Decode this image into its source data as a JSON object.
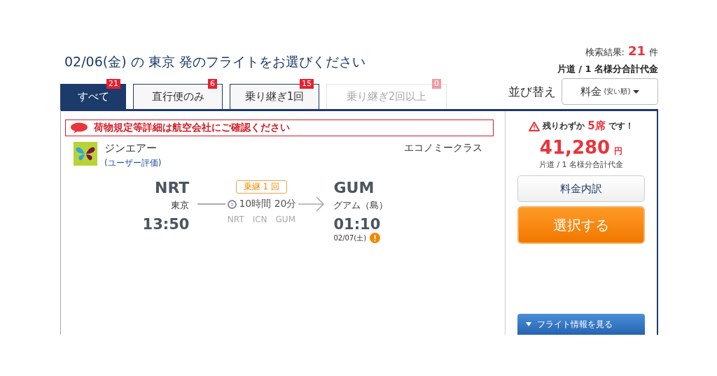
{
  "header": {
    "title": "02/06(金) の 東京 発のフライトをお選びください",
    "results_label": "検索結果:",
    "results_count": "21",
    "results_unit": "件",
    "fare_note": "片道 / 1 名様分合計代金"
  },
  "tabs": [
    {
      "label": "すべて",
      "count": "21",
      "selected": true,
      "disabled": false
    },
    {
      "label": "直行便のみ",
      "count": "6",
      "selected": false,
      "disabled": false
    },
    {
      "label": "乗り継ぎ1回",
      "count": "15",
      "selected": false,
      "disabled": false
    },
    {
      "label": "乗り継ぎ2回以上",
      "count": "0",
      "selected": false,
      "disabled": true
    }
  ],
  "sort": {
    "label": "並び替え",
    "value": "料金",
    "value_note": "(安い順)"
  },
  "flight": {
    "notice": "荷物規定等詳細は航空会社にご確認ください",
    "airline": "ジンエアー",
    "rating_link": "(ユーザー評価)",
    "cabin": "エコノミークラス",
    "origin": {
      "code": "NRT",
      "city": "東京",
      "time": "13:50"
    },
    "stops_badge": "乗継 1 回",
    "duration": "10時間 20分",
    "route": [
      "NRT",
      "ICN",
      "GUM"
    ],
    "destination": {
      "code": "GUM",
      "city": "グアム（島）",
      "time": "01:10",
      "date": "02/07(土)"
    }
  },
  "offer": {
    "seats_prefix": "残りわずか",
    "seats": "5席",
    "seats_suffix": "です！",
    "price": "41,280",
    "currency": "円",
    "price_note": "片道 / 1 名様分合計代金",
    "breakdown_button": "料金内訳",
    "select_button": "選択する",
    "details_button": "フライト情報を見る"
  }
}
